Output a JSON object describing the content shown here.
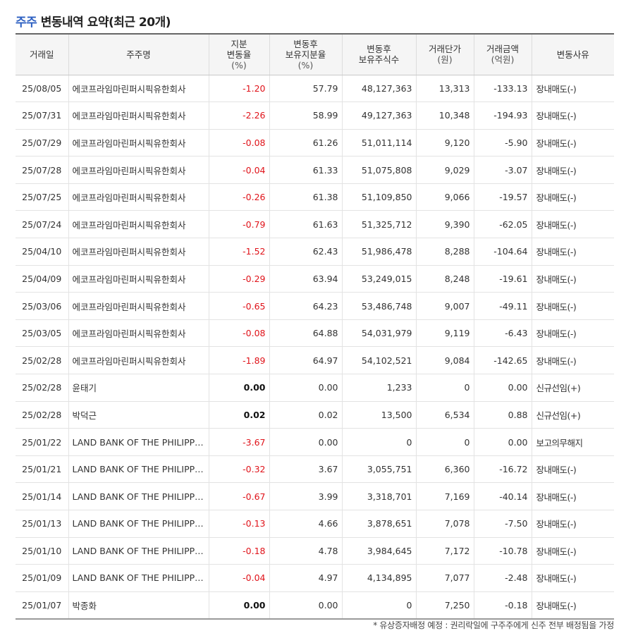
{
  "title": {
    "highlight": "주주",
    "rest": "변동내역 요약(최근 20개)"
  },
  "columns": {
    "date": {
      "l1": "거래일",
      "l2": "",
      "unit": ""
    },
    "holder": {
      "l1": "주주명",
      "l2": "",
      "unit": ""
    },
    "chg": {
      "l1": "지분",
      "l2": "변동율",
      "unit": "(%)"
    },
    "ratio": {
      "l1": "변동후",
      "l2": "보유지분율",
      "unit": "(%)"
    },
    "shares": {
      "l1": "변동후",
      "l2": "보유주식수",
      "unit": ""
    },
    "price": {
      "l1": "거래단가",
      "l2": "",
      "unit": "(원)"
    },
    "amount": {
      "l1": "거래금액",
      "l2": "",
      "unit": "(억원)"
    },
    "reason": {
      "l1": "변동사유",
      "l2": "",
      "unit": ""
    }
  },
  "rows": [
    {
      "date": "25/08/05",
      "holder": "에코프라임마린퍼시픽유한회사",
      "chg": "-1.20",
      "ratio": "57.79",
      "shares": "48,127,363",
      "price": "13,313",
      "amount": "-133.13",
      "reason": "장내매도(-)"
    },
    {
      "date": "25/07/31",
      "holder": "에코프라임마린퍼시픽유한회사",
      "chg": "-2.26",
      "ratio": "58.99",
      "shares": "49,127,363",
      "price": "10,348",
      "amount": "-194.93",
      "reason": "장내매도(-)"
    },
    {
      "date": "25/07/29",
      "holder": "에코프라임마린퍼시픽유한회사",
      "chg": "-0.08",
      "ratio": "61.26",
      "shares": "51,011,114",
      "price": "9,120",
      "amount": "-5.90",
      "reason": "장내매도(-)"
    },
    {
      "date": "25/07/28",
      "holder": "에코프라임마린퍼시픽유한회사",
      "chg": "-0.04",
      "ratio": "61.33",
      "shares": "51,075,808",
      "price": "9,029",
      "amount": "-3.07",
      "reason": "장내매도(-)"
    },
    {
      "date": "25/07/25",
      "holder": "에코프라임마린퍼시픽유한회사",
      "chg": "-0.26",
      "ratio": "61.38",
      "shares": "51,109,850",
      "price": "9,066",
      "amount": "-19.57",
      "reason": "장내매도(-)"
    },
    {
      "date": "25/07/24",
      "holder": "에코프라임마린퍼시픽유한회사",
      "chg": "-0.79",
      "ratio": "61.63",
      "shares": "51,325,712",
      "price": "9,390",
      "amount": "-62.05",
      "reason": "장내매도(-)"
    },
    {
      "date": "25/04/10",
      "holder": "에코프라임마린퍼시픽유한회사",
      "chg": "-1.52",
      "ratio": "62.43",
      "shares": "51,986,478",
      "price": "8,288",
      "amount": "-104.64",
      "reason": "장내매도(-)"
    },
    {
      "date": "25/04/09",
      "holder": "에코프라임마린퍼시픽유한회사",
      "chg": "-0.29",
      "ratio": "63.94",
      "shares": "53,249,015",
      "price": "8,248",
      "amount": "-19.61",
      "reason": "장내매도(-)"
    },
    {
      "date": "25/03/06",
      "holder": "에코프라임마린퍼시픽유한회사",
      "chg": "-0.65",
      "ratio": "64.23",
      "shares": "53,486,748",
      "price": "9,007",
      "amount": "-49.11",
      "reason": "장내매도(-)"
    },
    {
      "date": "25/03/05",
      "holder": "에코프라임마린퍼시픽유한회사",
      "chg": "-0.08",
      "ratio": "64.88",
      "shares": "54,031,979",
      "price": "9,119",
      "amount": "-6.43",
      "reason": "장내매도(-)"
    },
    {
      "date": "25/02/28",
      "holder": "에코프라임마린퍼시픽유한회사",
      "chg": "-1.89",
      "ratio": "64.97",
      "shares": "54,102,521",
      "price": "9,084",
      "amount": "-142.65",
      "reason": "장내매도(-)"
    },
    {
      "date": "25/02/28",
      "holder": "윤태기",
      "chg": "0.00",
      "ratio": "0.00",
      "shares": "1,233",
      "price": "0",
      "amount": "0.00",
      "reason": "신규선임(+)"
    },
    {
      "date": "25/02/28",
      "holder": "박덕근",
      "chg": "0.02",
      "ratio": "0.02",
      "shares": "13,500",
      "price": "6,534",
      "amount": "0.88",
      "reason": "신규선임(+)"
    },
    {
      "date": "25/01/22",
      "holder": "LAND BANK OF THE PHILIPPINES",
      "chg": "-3.67",
      "ratio": "0.00",
      "shares": "0",
      "price": "0",
      "amount": "0.00",
      "reason": "보고의무해지"
    },
    {
      "date": "25/01/21",
      "holder": "LAND BANK OF THE PHILIPPINES",
      "chg": "-0.32",
      "ratio": "3.67",
      "shares": "3,055,751",
      "price": "6,360",
      "amount": "-16.72",
      "reason": "장내매도(-)"
    },
    {
      "date": "25/01/14",
      "holder": "LAND BANK OF THE PHILIPPINES",
      "chg": "-0.67",
      "ratio": "3.99",
      "shares": "3,318,701",
      "price": "7,169",
      "amount": "-40.14",
      "reason": "장내매도(-)"
    },
    {
      "date": "25/01/13",
      "holder": "LAND BANK OF THE PHILIPPINES",
      "chg": "-0.13",
      "ratio": "4.66",
      "shares": "3,878,651",
      "price": "7,078",
      "amount": "-7.50",
      "reason": "장내매도(-)"
    },
    {
      "date": "25/01/10",
      "holder": "LAND BANK OF THE PHILIPPINES",
      "chg": "-0.18",
      "ratio": "4.78",
      "shares": "3,984,645",
      "price": "7,172",
      "amount": "-10.78",
      "reason": "장내매도(-)"
    },
    {
      "date": "25/01/09",
      "holder": "LAND BANK OF THE PHILIPPINES",
      "chg": "-0.04",
      "ratio": "4.97",
      "shares": "4,134,895",
      "price": "7,077",
      "amount": "-2.48",
      "reason": "장내매도(-)"
    },
    {
      "date": "25/01/07",
      "holder": "박종화",
      "chg": "0.00",
      "ratio": "0.00",
      "shares": "0",
      "price": "7,250",
      "amount": "-0.18",
      "reason": "장내매도(-)"
    }
  ],
  "footnote": "* 유상증자배정 예정 : 권리락일에 구주주에게 신주 전부 배정됨을 가정",
  "colors": {
    "accent": "#2c5fc1",
    "negative": "#e0131a"
  }
}
